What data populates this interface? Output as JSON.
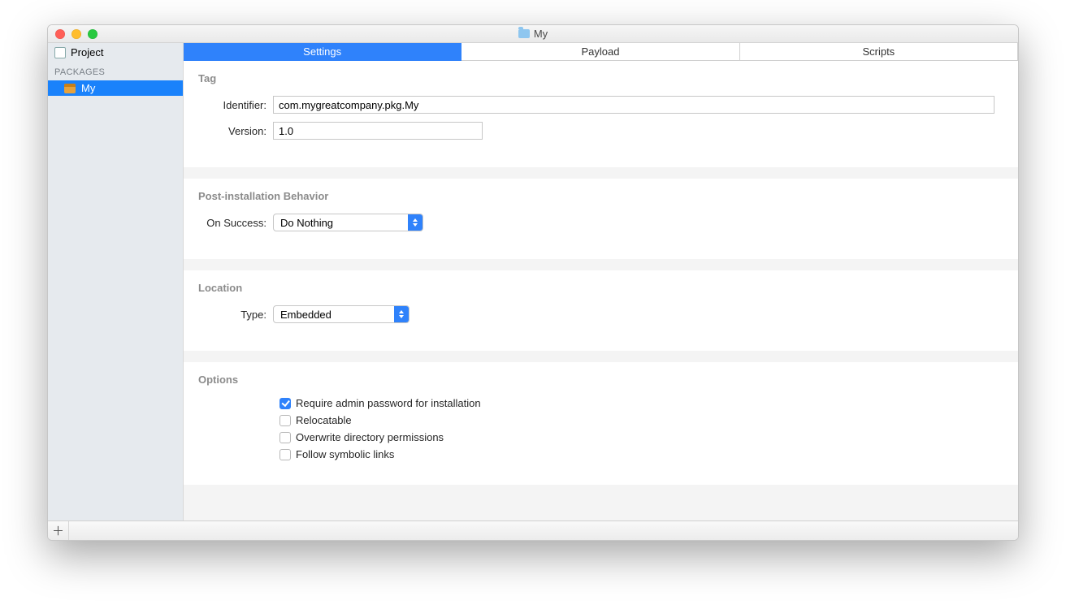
{
  "window": {
    "title": "My"
  },
  "sidebar": {
    "project_label": "Project",
    "group_label": "PACKAGES",
    "item_name": "My"
  },
  "tabs": {
    "settings": "Settings",
    "payload": "Payload",
    "scripts": "Scripts"
  },
  "sections": {
    "tag": {
      "title": "Tag",
      "identifier_label": "Identifier:",
      "identifier_value": "com.mygreatcompany.pkg.My",
      "version_label": "Version:",
      "version_value": "1.0"
    },
    "post": {
      "title": "Post-installation Behavior",
      "on_success_label": "On Success:",
      "on_success_value": "Do Nothing"
    },
    "location": {
      "title": "Location",
      "type_label": "Type:",
      "type_value": "Embedded"
    },
    "options": {
      "title": "Options",
      "require_admin": "Require admin password for installation",
      "relocatable": "Relocatable",
      "overwrite": "Overwrite directory permissions",
      "follow": "Follow symbolic links"
    }
  }
}
